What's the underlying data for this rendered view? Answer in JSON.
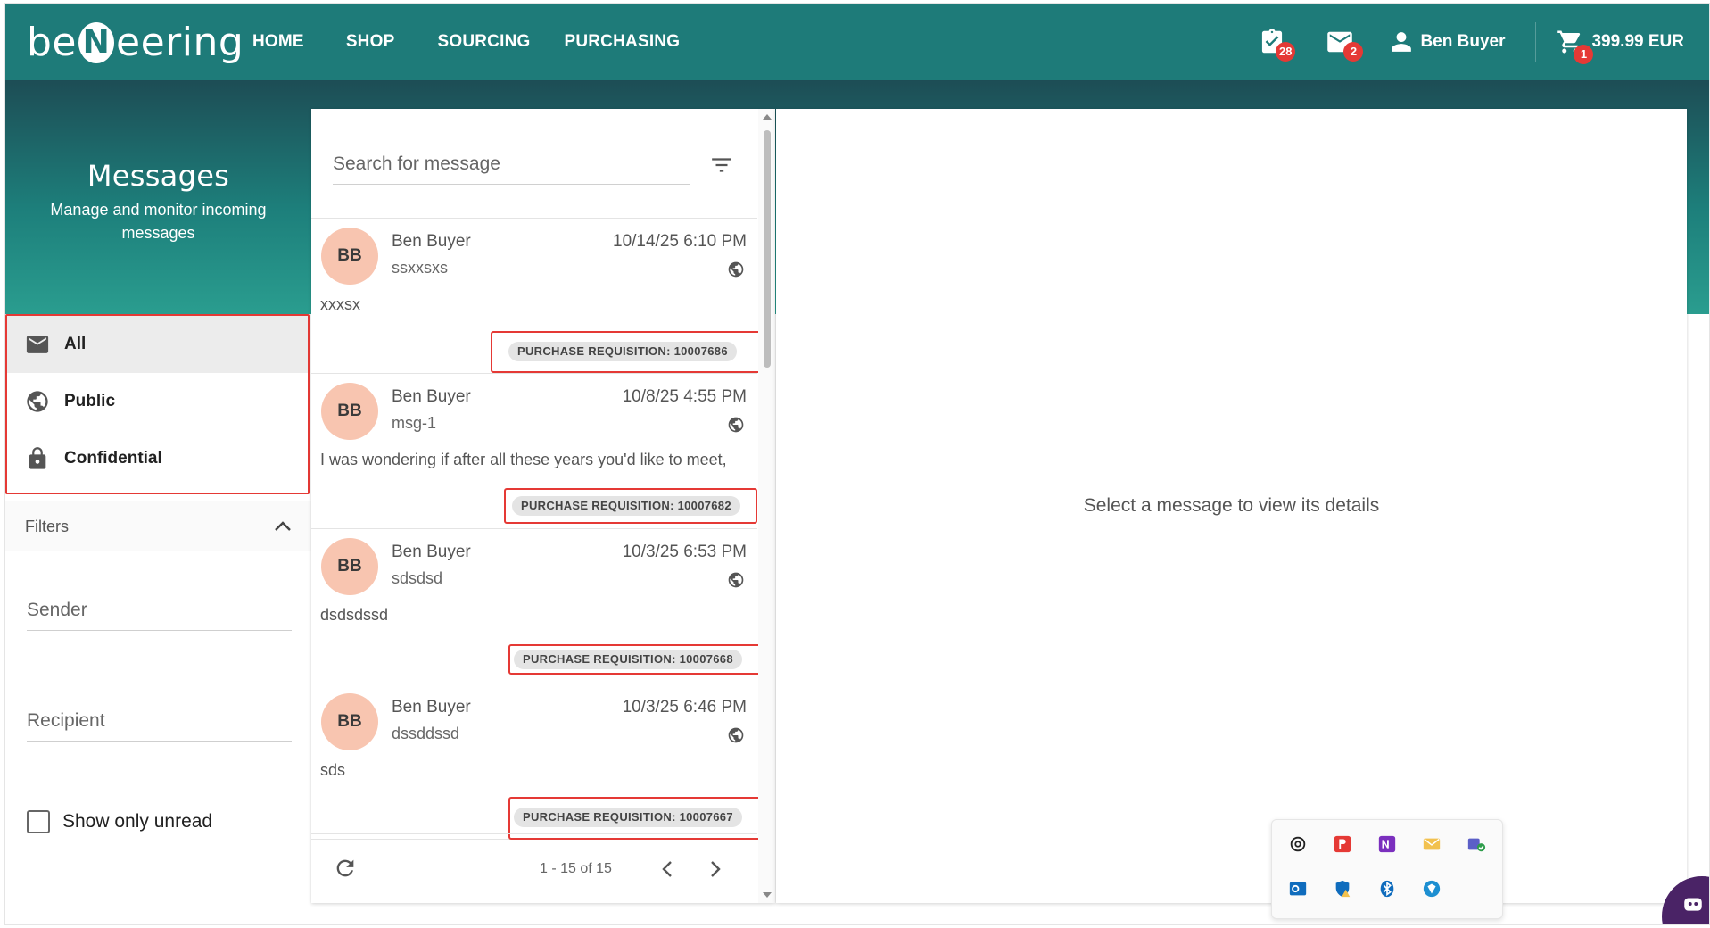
{
  "brand": {
    "logo_prefix": "be",
    "logo_letter": "N",
    "logo_suffix": "eering"
  },
  "nav": {
    "items": [
      "HOME",
      "SHOP",
      "SOURCING",
      "PURCHASING"
    ]
  },
  "header": {
    "tasks_badge": "28",
    "mail_badge": "2",
    "user_name": "Ben Buyer",
    "cart_badge": "1",
    "cart_total": "399.99 EUR"
  },
  "hero": {
    "title": "Messages",
    "subtitle": "Manage and monitor incoming messages"
  },
  "folders": [
    {
      "label": "All",
      "icon": "mail-icon"
    },
    {
      "label": "Public",
      "icon": "globe-icon"
    },
    {
      "label": "Confidential",
      "icon": "lock-icon"
    }
  ],
  "filters": {
    "title": "Filters",
    "sender_placeholder": "Sender",
    "recipient_placeholder": "Recipient",
    "unread_label": "Show only unread"
  },
  "search": {
    "placeholder": "Search for message"
  },
  "messages": [
    {
      "initials": "BB",
      "sender": "Ben Buyer",
      "date": "10/14/25 6:10 PM",
      "subject": "ssxxsxs",
      "body": "xxxsx",
      "tag": "PURCHASE REQUISITION: 10007686"
    },
    {
      "initials": "BB",
      "sender": "Ben Buyer",
      "date": "10/8/25 4:55 PM",
      "subject": "msg-1",
      "body": "I was wondering if after all these years you'd like to meet,",
      "tag": "PURCHASE REQUISITION: 10007682"
    },
    {
      "initials": "BB",
      "sender": "Ben Buyer",
      "date": "10/3/25 6:53 PM",
      "subject": "sdsdsd",
      "body": "dsdsdssd",
      "tag": "PURCHASE REQUISITION: 10007668"
    },
    {
      "initials": "BB",
      "sender": "Ben Buyer",
      "date": "10/3/25 6:46 PM",
      "subject": "dssddssd",
      "body": "sds",
      "tag": "PURCHASE REQUISITION: 10007667"
    }
  ],
  "pager": {
    "range": "1 - 15 of 15"
  },
  "detail": {
    "empty_text": "Select a message to view its details"
  },
  "colors": {
    "brand_teal": "#1e7b79",
    "badge_red": "#e53935",
    "avatar_peach": "#f8c5b0",
    "highlight_red": "#e53935"
  },
  "tray_icons": [
    "chatgpt-icon",
    "pdf-reader-icon",
    "onenote-icon",
    "mail-app-icon",
    "teams-icon",
    "outlook-icon",
    "security-shield-icon",
    "bluetooth-icon",
    "vpn-icon"
  ]
}
